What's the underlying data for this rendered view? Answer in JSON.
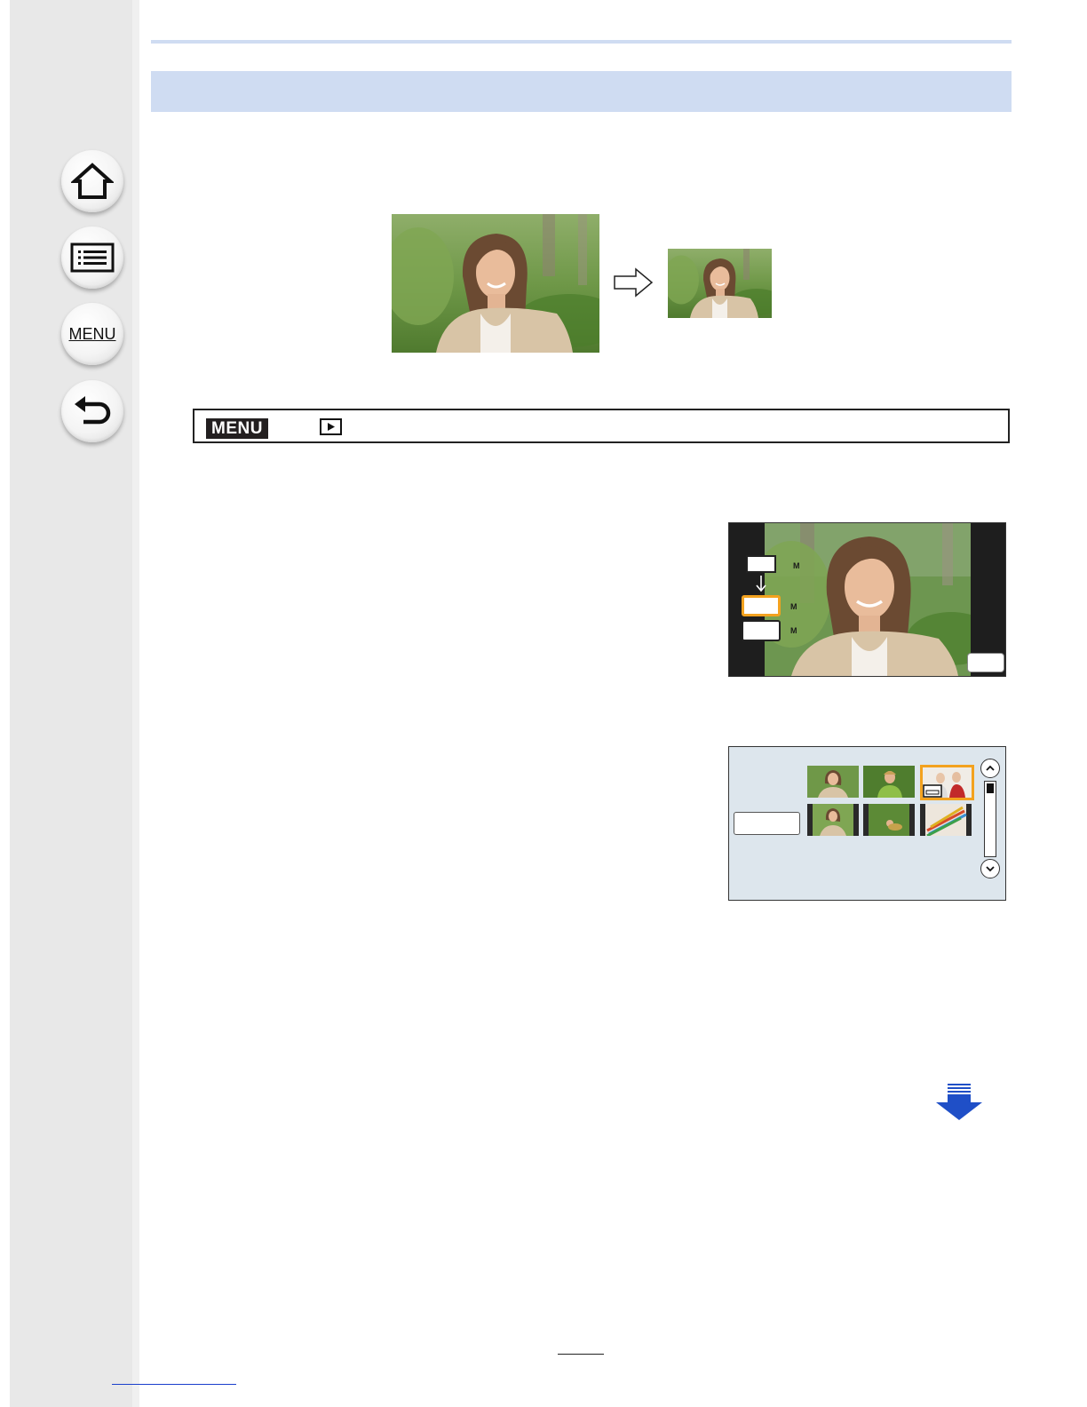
{
  "sidebar": {
    "buttons": [
      {
        "name": "home",
        "icon": "home-icon"
      },
      {
        "name": "contents",
        "icon": "list-icon"
      },
      {
        "name": "menu",
        "icon": "menu-icon",
        "label": "MENU"
      },
      {
        "name": "back",
        "icon": "back-arrow-icon"
      }
    ]
  },
  "menu_path": {
    "menu_chip": "MENU",
    "playback_icon": "playback-icon"
  },
  "colors": {
    "band": "#cfdcf2",
    "sidebar": "#e8e8e8",
    "highlight": "#f3a21f",
    "next_arrow": "#1f4fc7"
  }
}
